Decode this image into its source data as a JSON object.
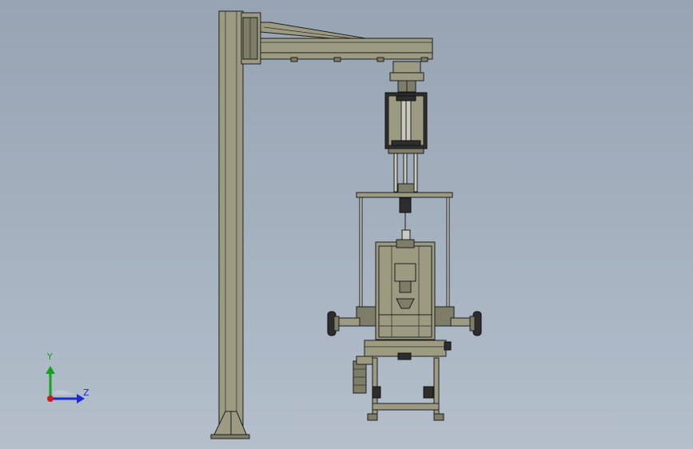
{
  "viewport": {
    "background_top": "#96a4b3",
    "background_bottom": "#b4bfcb",
    "part_fill": "#9c9b82",
    "part_fill_dark": "#7e7d68",
    "edge_color": "#1e1e1e"
  },
  "model": {
    "name": "jib-crane-with-lifting-gripper",
    "components": [
      "column",
      "jib-arm",
      "trolley",
      "cylinder-frame",
      "lifting-plate",
      "gripper-body",
      "wheel-left",
      "wheel-right",
      "base-frame",
      "gear-motor"
    ]
  },
  "triad": {
    "y_label": "Y",
    "z_label": "Z",
    "y_color": "#12a31a",
    "z_color": "#1b2bd0",
    "x_color": "#d01b1b"
  }
}
